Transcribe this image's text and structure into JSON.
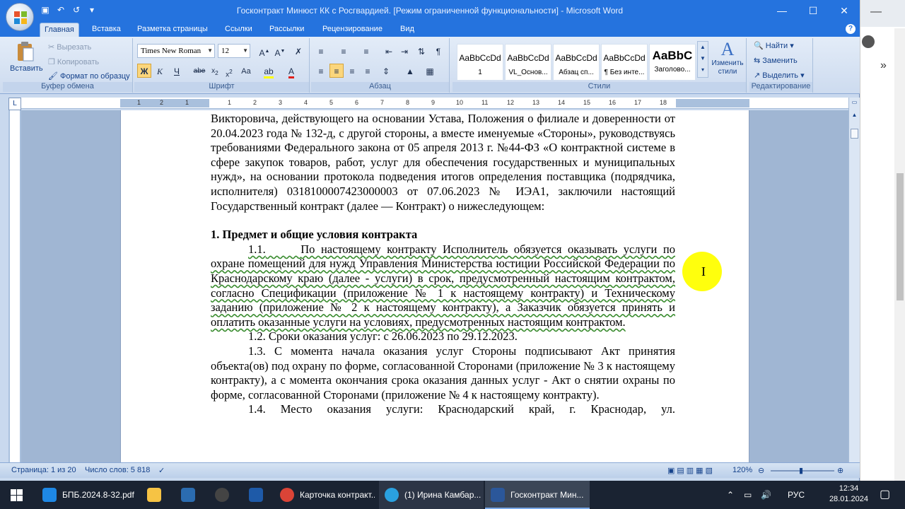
{
  "window": {
    "title": "Госконтракт Минюст КК с Росгвардией. [Режим ограниченной функциональности] - Microsoft Word",
    "controls": {
      "minimize": "—",
      "maximize": "☐",
      "close": "✕"
    }
  },
  "tabs": [
    "Главная",
    "Вставка",
    "Разметка страницы",
    "Ссылки",
    "Рассылки",
    "Рецензирование",
    "Вид"
  ],
  "ribbon": {
    "clipboard": {
      "label": "Буфер обмена",
      "paste": "Вставить",
      "cut": "Вырезать",
      "copy": "Копировать",
      "format_painter": "Формат по образцу"
    },
    "font": {
      "label": "Шрифт",
      "font_name": "Times New Roman",
      "font_size": "12"
    },
    "paragraph": {
      "label": "Абзац"
    },
    "styles": {
      "label": "Стили",
      "items": [
        {
          "sample": "AaBbCcDd",
          "name": "1"
        },
        {
          "sample": "AaBbCcDd",
          "name": "VL_Основ..."
        },
        {
          "sample": "AaBbCcDd",
          "name": "Абзац сп..."
        },
        {
          "sample": "AaBbCcDd",
          "name": "¶ Без инте..."
        },
        {
          "sample": "AaBbC",
          "name": "Заголово..."
        }
      ],
      "change_styles": "Изменить стили"
    },
    "editing": {
      "label": "Редактирование",
      "find": "Найти",
      "replace": "Заменить",
      "select": "Выделить"
    }
  },
  "ruler": [
    "1",
    "2",
    "1",
    "1",
    "2",
    "3",
    "4",
    "5",
    "6",
    "7",
    "8",
    "9",
    "10",
    "11",
    "12",
    "13",
    "14",
    "15",
    "16",
    "17",
    "18"
  ],
  "document": {
    "p1": "Викторовича, действующего на основании Устава, Положения о филиале и доверенности от 20.04.2023 года № 132-д, с другой стороны, а вместе именуемые «Стороны», руководствуясь требованиями Федерального закона от 05 апреля 2013 г. №44-ФЗ «О контрактной системе в сфере закупок товаров, работ, услуг для обеспечения государственных и муниципальных нужд», на основании протокола подведения итогов определения поставщика (подрядчика, исполнителя) 0318100007423000003 от 07.06.2023 № ИЭА1, заключили настоящий Государственный контракт (далее — Контракт) о нижеследующем:",
    "heading": "1. Предмет и общие условия контракта",
    "p11_num": "1.1.",
    "p11": "По настоящему контракту Исполнитель обязуется оказывать услуги по охране помещений для нужд Управления Министерства юстиции Российской Федерации по Краснодарскому краю (далее - услуги) в срок, предусмотренный настоящим контрактом, согласно Спецификации (приложение № 1 к настоящему контракту) и Техническому заданию (приложение № 2 к настоящему контракту), а Заказчик обязуется принять и оплатить оказанные услуги на условиях, предусмотренных настоящим контрактом.",
    "p12": "1.2. Сроки оказания услуг: с 26.06.2023 по 29.12.2023.",
    "p13": "1.3. С момента начала оказания услуг Стороны подписывают Акт принятия объекта(ов) под охрану по форме, согласованной Сторонами (приложение № 3 к настоящему контракту), а с момента окончания срока оказания данных услуг - Акт о снятии охраны по форме, согласованной Сторонами (приложение № 4 к настоящему контракту).",
    "p14": "1.4. Место оказания услуги: Краснодарский край, г. Краснодар, ул."
  },
  "status": {
    "page": "Страница: 1 из 20",
    "words": "Число слов: 5 818",
    "zoom": "120%"
  },
  "taskbar": {
    "items": [
      {
        "label": "БПБ.2024.8-32.pdf ...",
        "color": "#1e88e5"
      },
      {
        "label": "",
        "color": "#f6c344"
      },
      {
        "label": "",
        "color": "#2b6cb0"
      },
      {
        "label": "",
        "color": "#444"
      },
      {
        "label": "",
        "color": "#1e5aa8"
      },
      {
        "label": "Карточка контракт...",
        "color": "#db4437"
      },
      {
        "label": "(1) Ирина Камбар...",
        "color": "#2aa1e0"
      },
      {
        "label": "Госконтракт Мин...",
        "color": "#2b579a"
      }
    ],
    "lang": "РУС",
    "time": "12:34",
    "date": "28.01.2024"
  }
}
